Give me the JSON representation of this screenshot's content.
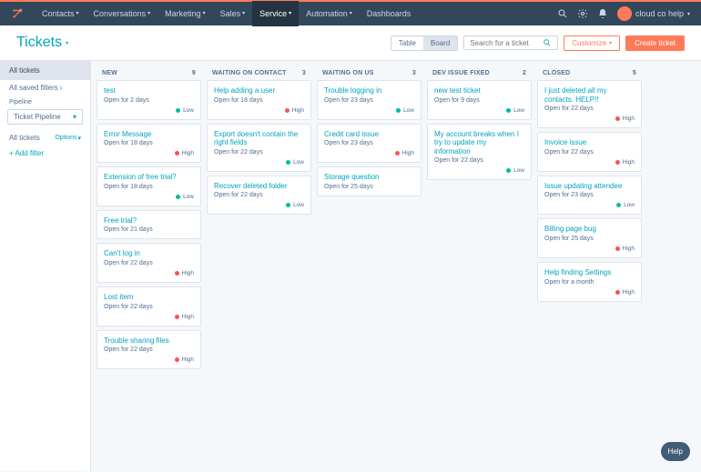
{
  "nav": {
    "items": [
      {
        "label": "Contacts"
      },
      {
        "label": "Conversations"
      },
      {
        "label": "Marketing"
      },
      {
        "label": "Sales"
      },
      {
        "label": "Service"
      },
      {
        "label": "Automation"
      },
      {
        "label": "Dashboards"
      }
    ],
    "active_index": 4,
    "user_label": "cloud co help"
  },
  "header": {
    "title": "Tickets",
    "view_table": "Table",
    "view_board": "Board",
    "view_active": "board",
    "search_placeholder": "Search for a ticket",
    "customize_label": "Customize",
    "create_label": "Create ticket"
  },
  "sidebar": {
    "filter_active": "All tickets",
    "saved_filters": "All saved filters",
    "pipeline_label": "Pipeline",
    "pipeline_value": "Ticket Pipeline",
    "options": "Options",
    "add_filter": "+ Add filter"
  },
  "board": {
    "columns": [
      {
        "name": "NEW",
        "count": 9,
        "cards": [
          {
            "title": "test",
            "sub": "Open for 2 days",
            "pri": "Low"
          },
          {
            "title": "Error Message",
            "sub": "Open for 18 days",
            "pri": "High"
          },
          {
            "title": "Extension of free trial?",
            "sub": "Open for 18 days",
            "pri": "Low"
          },
          {
            "title": "Free trial?",
            "sub": "Open for 21 days",
            "pri": ""
          },
          {
            "title": "Can't log in",
            "sub": "Open for 22 days",
            "pri": "High"
          },
          {
            "title": "Lost item",
            "sub": "Open for 22 days",
            "pri": "High"
          },
          {
            "title": "Trouble sharing files",
            "sub": "Open for 22 days",
            "pri": "High"
          }
        ]
      },
      {
        "name": "WAITING ON CONTACT",
        "count": 3,
        "cards": [
          {
            "title": "Help adding a user",
            "sub": "Open for 18 days",
            "pri": "High"
          },
          {
            "title": "Export doesn't contain the right fields",
            "sub": "Open for 22 days",
            "pri": "Low"
          },
          {
            "title": "Recover deleted folder",
            "sub": "Open for 22 days",
            "pri": "Low"
          }
        ]
      },
      {
        "name": "WAITING ON US",
        "count": 3,
        "cards": [
          {
            "title": "Trouble logging in",
            "sub": "Open for 23 days",
            "pri": "Low"
          },
          {
            "title": "Credit card issue",
            "sub": "Open for 23 days",
            "pri": "High"
          },
          {
            "title": "Storage question",
            "sub": "Open for 25 days",
            "pri": ""
          }
        ]
      },
      {
        "name": "DEV ISSUE FIXED",
        "count": 2,
        "cards": [
          {
            "title": "new test ticket",
            "sub": "Open for 9 days",
            "pri": "Low"
          },
          {
            "title": "My account breaks when I try to update my information",
            "sub": "Open for 22 days",
            "pri": "Low"
          }
        ]
      },
      {
        "name": "CLOSED",
        "count": 5,
        "cards": [
          {
            "title": "I just deleted all my contacts. HELP!!",
            "sub": "Open for 22 days",
            "pri": "High"
          },
          {
            "title": "Invoice issue",
            "sub": "Open for 22 days",
            "pri": "High"
          },
          {
            "title": "Issue updating attendee",
            "sub": "Open for 23 days",
            "pri": "Low"
          },
          {
            "title": "Billing page bug",
            "sub": "Open for 25 days",
            "pri": "High"
          },
          {
            "title": "Help finding Settings",
            "sub": "Open for a month",
            "pri": "High"
          }
        ]
      }
    ]
  },
  "help_fab": "Help"
}
